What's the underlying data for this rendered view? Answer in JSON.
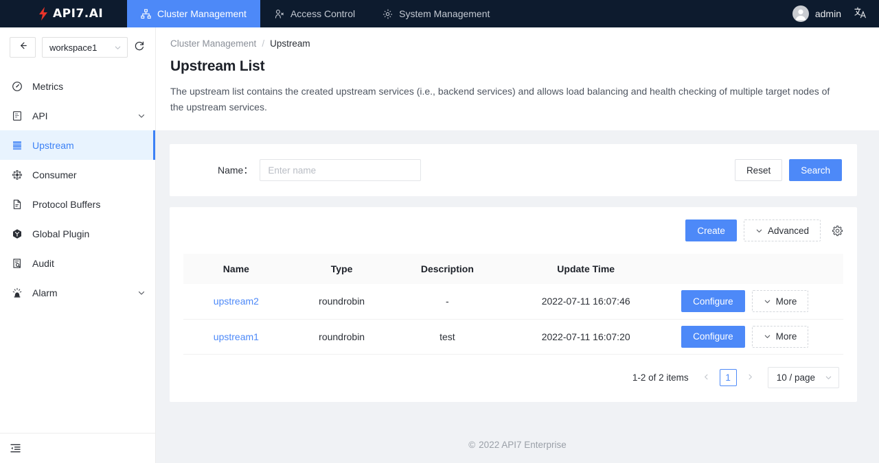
{
  "topnav": {
    "brand": "API7.AI",
    "brand_icon": "lightning-bolt-icon",
    "items": [
      {
        "label": "Cluster Management",
        "icon": "sitemap-icon",
        "active": true
      },
      {
        "label": "Access Control",
        "icon": "user-shield-icon",
        "active": false
      },
      {
        "label": "System Management",
        "icon": "gear-icon",
        "active": false
      }
    ],
    "user": "admin",
    "language_icon": "translate-icon",
    "accent": "#4d89f8",
    "background": "#0d1b2e"
  },
  "sidebar": {
    "back_icon": "arrow-left-icon",
    "workspace": "workspace1",
    "refresh_icon": "refresh-icon",
    "collapse_icon": "menu-collapse-icon",
    "items": [
      {
        "label": "Metrics",
        "icon": "dashboard-icon",
        "active": false,
        "chevron": false
      },
      {
        "label": "API",
        "icon": "api-document-icon",
        "active": false,
        "chevron": true
      },
      {
        "label": "Upstream",
        "icon": "server-stack-icon",
        "active": true,
        "chevron": false
      },
      {
        "label": "Consumer",
        "icon": "nodes-network-icon",
        "active": false,
        "chevron": false
      },
      {
        "label": "Protocol Buffers",
        "icon": "file-code-icon",
        "active": false,
        "chevron": false
      },
      {
        "label": "Global Plugin",
        "icon": "cube-plugin-icon",
        "active": false,
        "chevron": false
      },
      {
        "label": "Audit",
        "icon": "file-search-icon",
        "active": false,
        "chevron": false
      },
      {
        "label": "Alarm",
        "icon": "siren-alarm-icon",
        "active": false,
        "chevron": true
      }
    ],
    "active_color": "#3c81f6",
    "active_bg": "#e8f3fe"
  },
  "page": {
    "breadcrumb": {
      "parent": "Cluster Management",
      "separator": "/",
      "current": "Upstream"
    },
    "title": "Upstream List",
    "description": "The upstream list contains the created upstream services (i.e., backend services) and allows load balancing and health checking of multiple target nodes of the upstream services."
  },
  "filter": {
    "name_label": "Name：",
    "name_value": "",
    "name_placeholder": "Enter name",
    "reset_label": "Reset",
    "search_label": "Search"
  },
  "toolbar": {
    "create_label": "Create",
    "advanced_label": "Advanced",
    "advanced_icon": "chevron-down-icon",
    "settings_icon": "gear-icon"
  },
  "table": {
    "columns": [
      "Name",
      "Type",
      "Description",
      "Update Time",
      ""
    ],
    "rows": [
      {
        "name": "upstream2",
        "type": "roundrobin",
        "description": "-",
        "update_time": "2022-07-11 16:07:46",
        "configure_label": "Configure",
        "more_label": "More"
      },
      {
        "name": "upstream1",
        "type": "roundrobin",
        "description": "test",
        "update_time": "2022-07-11 16:07:20",
        "configure_label": "Configure",
        "more_label": "More"
      }
    ]
  },
  "pagination": {
    "total_text": "1-2 of 2 items",
    "prev_icon": "chevron-left-icon",
    "next_icon": "chevron-right-icon",
    "current_page": "1",
    "page_size": "10 / page"
  },
  "footer": {
    "copyright_mark": "©",
    "text": "2022 API7 Enterprise"
  }
}
